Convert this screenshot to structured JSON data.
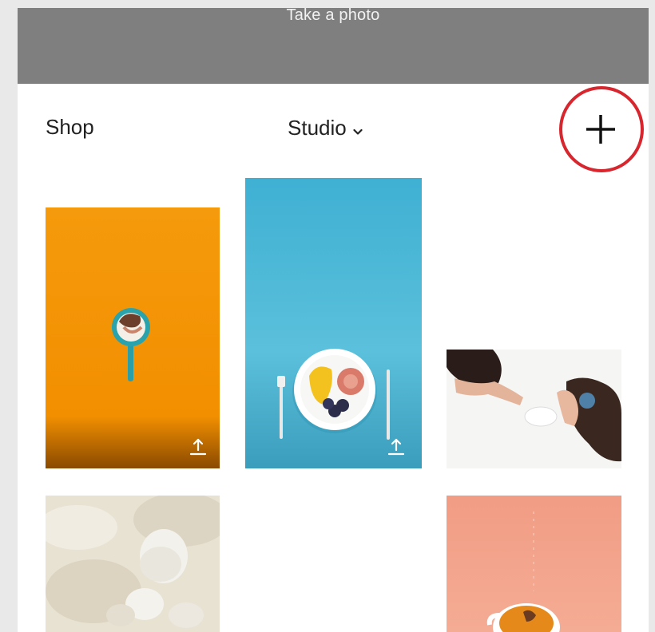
{
  "banner": {
    "label": "Take a photo",
    "color": "#7f7f7f"
  },
  "nav": {
    "left_label": "Shop",
    "center_label": "Studio",
    "center_icon": "chevron-down-icon",
    "right_icon": "plus-icon",
    "highlight_color": "#d8262e"
  },
  "grid": {
    "tiles": [
      {
        "id": "orange-mirror",
        "background": "#f39200",
        "icon": "share-icon"
      },
      {
        "id": "blue-breakfast-plate",
        "background": "#4fb8d6",
        "icon": "share-icon"
      },
      {
        "id": "kids-drawing",
        "background": "#f6f6f6"
      },
      {
        "id": "stones",
        "background": "#e7e1d2"
      },
      {
        "id": "coral-teacup",
        "background": "#f4a38a"
      }
    ]
  }
}
